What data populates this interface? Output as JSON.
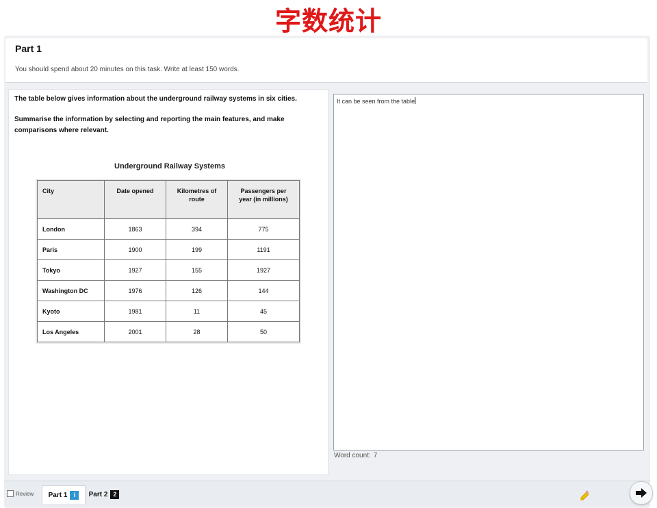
{
  "banner": {
    "title": "字数统计",
    "color": "#e01818"
  },
  "header": {
    "part_title": "Part 1",
    "instructions": "You should spend about 20 minutes on this task. Write at least 150 words."
  },
  "task": {
    "prompt": "The table below gives information about the underground railway systems in six cities.",
    "instruction": "Summarise the information by selecting and reporting the main features, and make comparisons where relevant."
  },
  "table": {
    "title": "Underground Railway Systems",
    "headers": {
      "city": "City",
      "date": "Date opened",
      "km": "Kilometres of route",
      "passengers": "Passengers per year (in millions)"
    },
    "rows": [
      {
        "city": "London",
        "date": "1863",
        "km": "394",
        "passengers": "775"
      },
      {
        "city": "Paris",
        "date": "1900",
        "km": "199",
        "passengers": "1191"
      },
      {
        "city": "Tokyo",
        "date": "1927",
        "km": "155",
        "passengers": "1927"
      },
      {
        "city": "Washington DC",
        "date": "1976",
        "km": "126",
        "passengers": "144"
      },
      {
        "city": "Kyoto",
        "date": "1981",
        "km": "11",
        "passengers": "45"
      },
      {
        "city": "Los Angeles",
        "date": "2001",
        "km": "28",
        "passengers": "50"
      }
    ]
  },
  "answer": {
    "text": "It can be seen from the table",
    "word_count_label": "Word count:",
    "word_count": "7"
  },
  "bottom": {
    "review_label": "Review",
    "tab1_label": "Part 1",
    "tab1_badge": "i",
    "tab2_label": "Part 2",
    "tab2_badge": "2"
  },
  "icons": {
    "info": "info-icon",
    "pencil": "pencil-icon",
    "next": "arrow-right-icon"
  }
}
